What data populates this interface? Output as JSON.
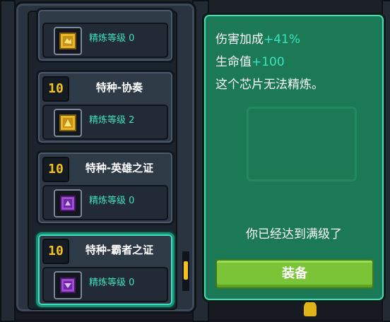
{
  "chips": [
    {
      "level": "",
      "name": "",
      "refine_label": "精炼等级",
      "refine_value": "0",
      "icon": "gold-chip-icon",
      "accent": "#e8b72a"
    },
    {
      "level": "10",
      "name": "特种-协奏",
      "refine_label": "精炼等级",
      "refine_value": "2",
      "icon": "gold-chip-icon",
      "accent": "#e8b72a"
    },
    {
      "level": "10",
      "name": "特种-英雄之证",
      "refine_label": "精炼等级",
      "refine_value": "0",
      "icon": "purple-chip-icon",
      "accent": "#a24bd6"
    },
    {
      "level": "10",
      "name": "特种-霸者之证",
      "refine_label": "精炼等级",
      "refine_value": "0",
      "icon": "purple-chip-icon",
      "accent": "#a24bd6"
    }
  ],
  "detail": {
    "stat1_label": "伤害加成",
    "stat1_value": "+41%",
    "stat2_label": "生命值",
    "stat2_value": "+100",
    "note": "这个芯片无法精炼。",
    "maxed_text": "你已经达到满级了",
    "equip_label": "装备"
  },
  "colors": {
    "teal": "#3fe0bf",
    "level_yellow": "#f2c21d",
    "detail_green": "#1b7a55",
    "button_green": "#7cc437"
  }
}
